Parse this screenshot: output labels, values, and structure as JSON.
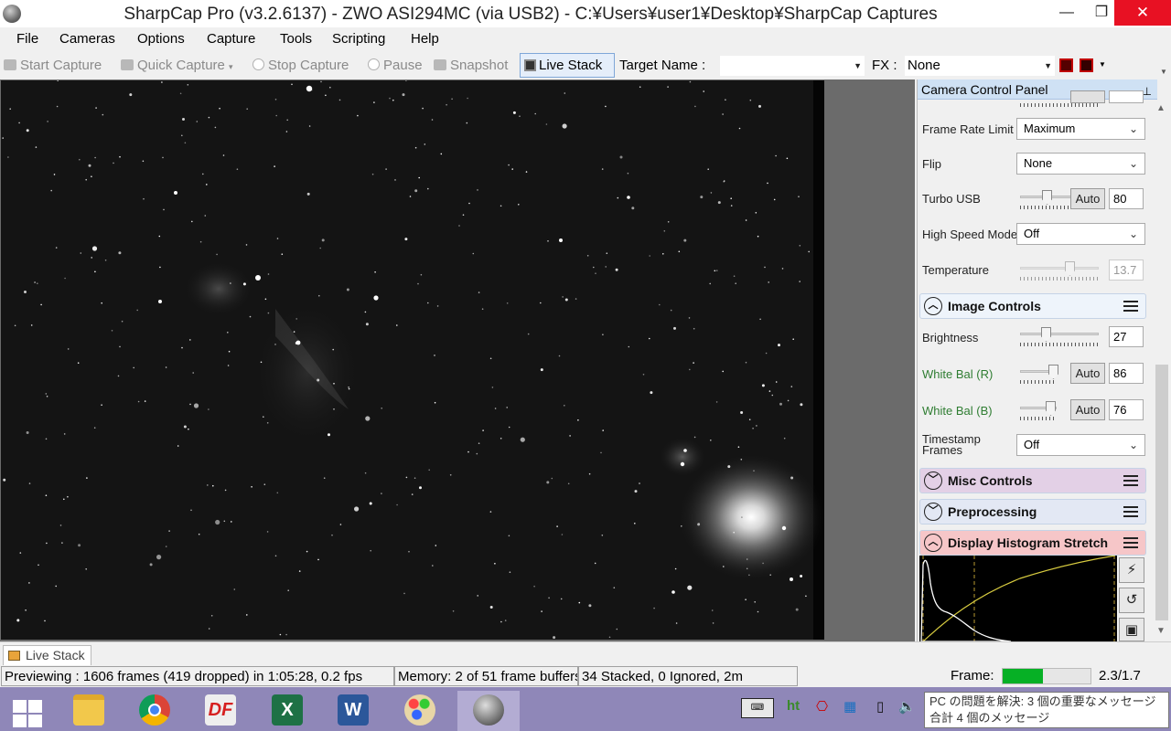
{
  "window": {
    "title": "SharpCap Pro (v3.2.6137) - ZWO ASI294MC (via USB2) - C:¥Users¥user1¥Desktop¥SharpCap Captures",
    "minimize": "—",
    "maximize": "❐",
    "close": "✕"
  },
  "menu": [
    "File",
    "Cameras",
    "Options",
    "Capture",
    "Tools",
    "Scripting",
    "Help"
  ],
  "toolbar": {
    "start_capture": "Start Capture",
    "quick_capture": "Quick Capture",
    "stop_capture": "Stop Capture",
    "pause": "Pause",
    "snapshot": "Snapshot",
    "live_stack": "Live Stack",
    "target_label": "Target Name :",
    "target_value": "",
    "fx_label": "FX :",
    "fx_value": "None"
  },
  "panel": {
    "title": "Camera Control Panel",
    "frame_rate_limit": {
      "label": "Frame Rate Limit",
      "value": "Maximum"
    },
    "flip": {
      "label": "Flip",
      "value": "None"
    },
    "turbo_usb": {
      "label": "Turbo USB",
      "auto": "Auto",
      "value": "80"
    },
    "high_speed_mode": {
      "label": "High Speed Mode",
      "value": "Off"
    },
    "temperature": {
      "label": "Temperature",
      "value": "13.7"
    },
    "image_controls": "Image Controls",
    "brightness": {
      "label": "Brightness",
      "value": "27"
    },
    "white_bal_r": {
      "label": "White Bal (R)",
      "auto": "Auto",
      "value": "86"
    },
    "white_bal_b": {
      "label": "White Bal (B)",
      "auto": "Auto",
      "value": "76"
    },
    "timestamp_frames": {
      "label_1": "Timestamp",
      "label_2": "Frames",
      "value": "Off"
    },
    "misc_controls": "Misc Controls",
    "preprocessing": "Preprocessing",
    "display_histogram_stretch": "Display Histogram Stretch"
  },
  "bottom_tab": "Live Stack",
  "status": {
    "previewing": "Previewing : 1606 frames (419 dropped) in 1:05:28, 0.2 fps",
    "memory": "Memory: 2 of 51 frame buffers",
    "stacked": "34 Stacked, 0 Ignored, 2m",
    "frame_label": "Frame:",
    "frame_ratio": "2.3/1.7",
    "frame_progress": 0.46
  },
  "taskbar": {
    "apps": [
      "windows-start",
      "file-explorer",
      "chrome",
      "deepskystacker",
      "excel",
      "word",
      "paint",
      "sharpcap"
    ],
    "notification_line1": "PC の問題を解決: 3 個の重要なメッセージ",
    "notification_line2": "合計 4 個のメッセージ"
  },
  "colors": {
    "accent_green": "#06b025",
    "close_red": "#e81123",
    "taskbar": "#8f87b8"
  }
}
